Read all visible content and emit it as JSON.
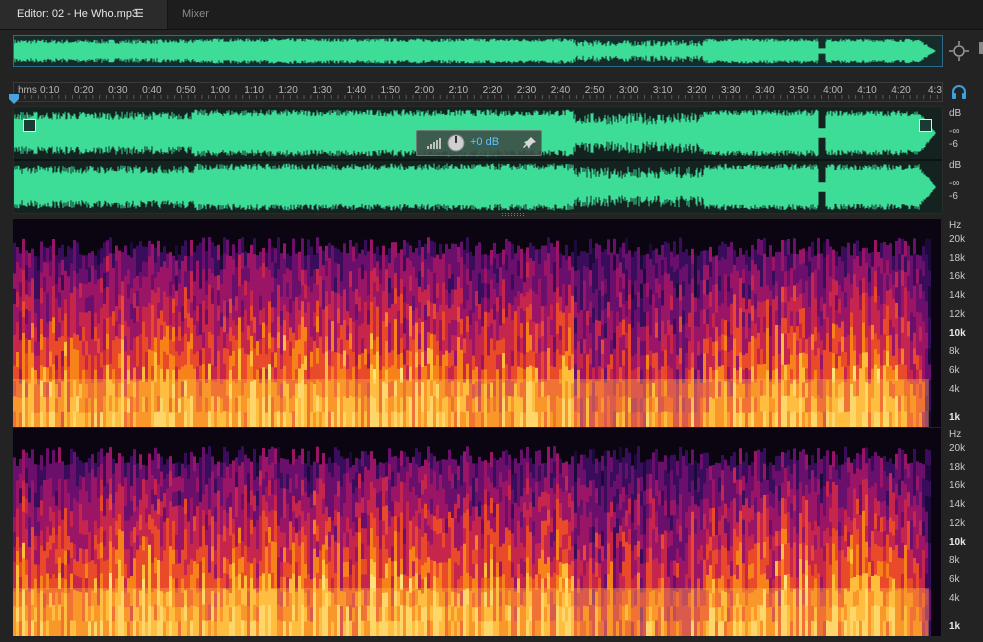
{
  "tabs": {
    "editor_label": "Editor: 02 - He Who.mp3",
    "menu_glyph": "☰",
    "mixer_label": "Mixer"
  },
  "icons": {
    "zoom": "zoom-to-selection-icon",
    "headphones": "headphones-icon",
    "playhead": "playhead-marker-icon",
    "pin": "pin-icon",
    "bars": "level-bars-icon",
    "knob": "volume-knob-icon"
  },
  "colors": {
    "waveform": "#3ddc97",
    "overview_border": "#2d6a8c",
    "hud_value": "#5fc3ff"
  },
  "ruler": {
    "labels": [
      "hms",
      "0:10",
      "0:20",
      "0:30",
      "0:40",
      "0:50",
      "1:00",
      "1:10",
      "1:20",
      "1:30",
      "1:40",
      "1:50",
      "2:00",
      "2:10",
      "2:20",
      "2:30",
      "2:40",
      "2:50",
      "3:00",
      "3:10",
      "3:20",
      "3:30",
      "3:40",
      "3:50",
      "4:00",
      "4:10",
      "4:20",
      "4:3"
    ]
  },
  "hud": {
    "value": "+0 dB"
  },
  "db_scale": {
    "unit": "dB",
    "ticks": [
      "-∞",
      "-6"
    ]
  },
  "hz_scale": {
    "unit": "Hz",
    "ticks": [
      "20k",
      "18k",
      "16k",
      "14k",
      "12k",
      "10k",
      "8k",
      "6k",
      "4k",
      "1k"
    ]
  }
}
